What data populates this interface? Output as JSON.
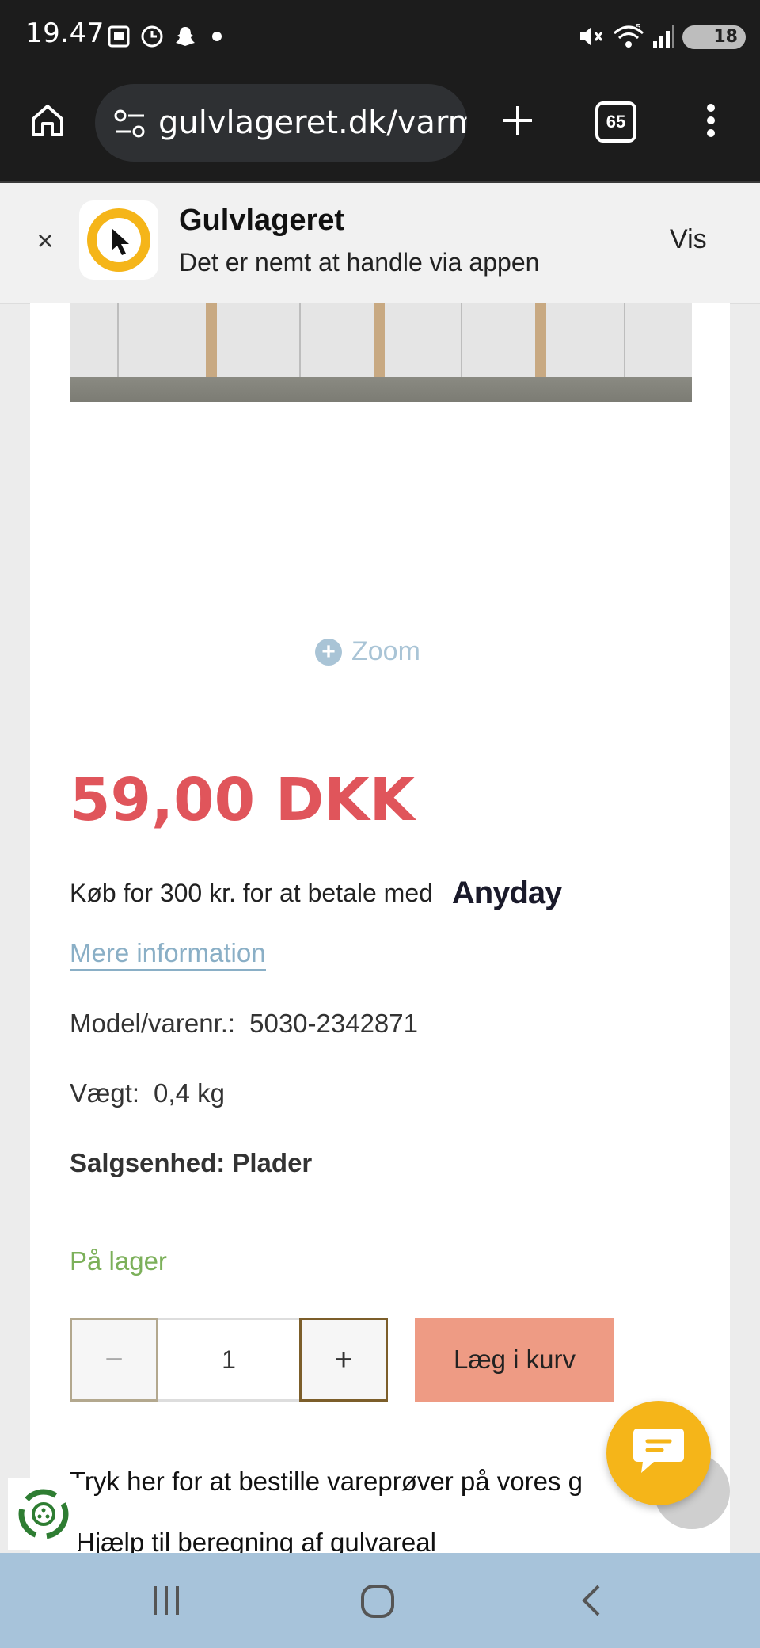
{
  "status_bar": {
    "time": "19.47",
    "battery": "18",
    "network": "5"
  },
  "browser": {
    "url": "gulvlageret.dk/varme",
    "tab_count": "65"
  },
  "app_banner": {
    "title": "Gulvlageret",
    "subtitle": "Det er nemt at handle via appen",
    "action_label": "Vis",
    "close_symbol": "×"
  },
  "product": {
    "zoom_label": "Zoom",
    "price": "59,00 DKK",
    "anyday_text": "Køb for 300 kr. for at betale med",
    "anyday_brand": "Anyday",
    "more_info": "Mere information",
    "model_label": "Model/varenr.:",
    "model_value": "5030-2342871",
    "weight_label": "Vægt:",
    "weight_value": "0,4 kg",
    "sales_unit": "Salgsenhed: Plader",
    "stock_status": "På lager",
    "quantity": "1",
    "minus_symbol": "−",
    "plus_symbol": "+",
    "add_to_cart": "Læg i kurv",
    "samples_text": "Tryk her for at bestille vareprøver på vores g",
    "helper_text": "Hjælp til beregning af gulvareal"
  },
  "colors": {
    "price": "#e0555b",
    "in_stock": "#7cb05a",
    "add_to_cart_bg": "#ee9b84",
    "chat_button": "#f5b519",
    "nav_bar": "#a7c3da"
  }
}
